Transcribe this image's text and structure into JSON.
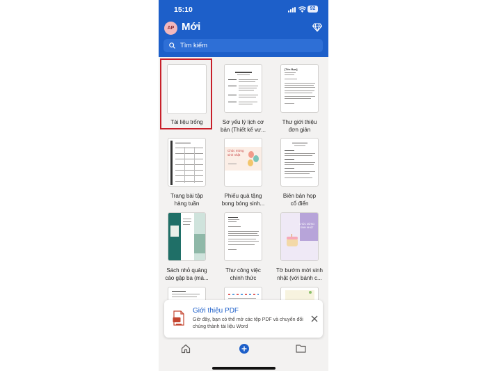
{
  "status_bar": {
    "time": "15:10",
    "battery": "92"
  },
  "header": {
    "avatar_initials": "AP",
    "title": "Mới",
    "search_placeholder": "Tìm kiếm"
  },
  "templates": [
    {
      "name": "Tài liệu trống",
      "line2": ""
    },
    {
      "name": "Sơ yếu lý lịch cơ",
      "line2": "bản (Thiết kế vư..."
    },
    {
      "name": "Thư giới thiệu",
      "line2": "đơn giản"
    },
    {
      "name": "Trang bài tập",
      "line2": "hàng tuần"
    },
    {
      "name": "Phiếu quà tặng",
      "line2": "bong bóng sinh..."
    },
    {
      "name": "Biên bản họp",
      "line2": "cổ điển"
    },
    {
      "name": "Sách nhỏ quảng",
      "line2": "cáo gập ba (mà..."
    },
    {
      "name": "Thư công việc",
      "line2": "chính thức"
    },
    {
      "name": "Tờ bướm mời sinh",
      "line2": "nhật (với bánh c..."
    }
  ],
  "thumb_text": {
    "cover_letter_heading": "[Tên Bạn]",
    "gift_card_title": "Chúc mừng sinh nhật",
    "flyer_title": "CHÚC MỪNG SINH NHẬT"
  },
  "toast": {
    "title": "Giới thiệu PDF",
    "body": "Giờ đây, bạn có thể mở các tệp PDF và chuyển đổi chúng thành tài liệu Word"
  },
  "colors": {
    "brand": "#1d5fc9",
    "highlight": "#c8202a",
    "teal": "#1f6f67",
    "lilac": "#b7a4d9"
  },
  "icons": {
    "search": "search-icon",
    "premium": "diamond-icon",
    "close": "close-icon",
    "home": "home-icon",
    "add": "plus-icon",
    "folder": "folder-icon"
  }
}
